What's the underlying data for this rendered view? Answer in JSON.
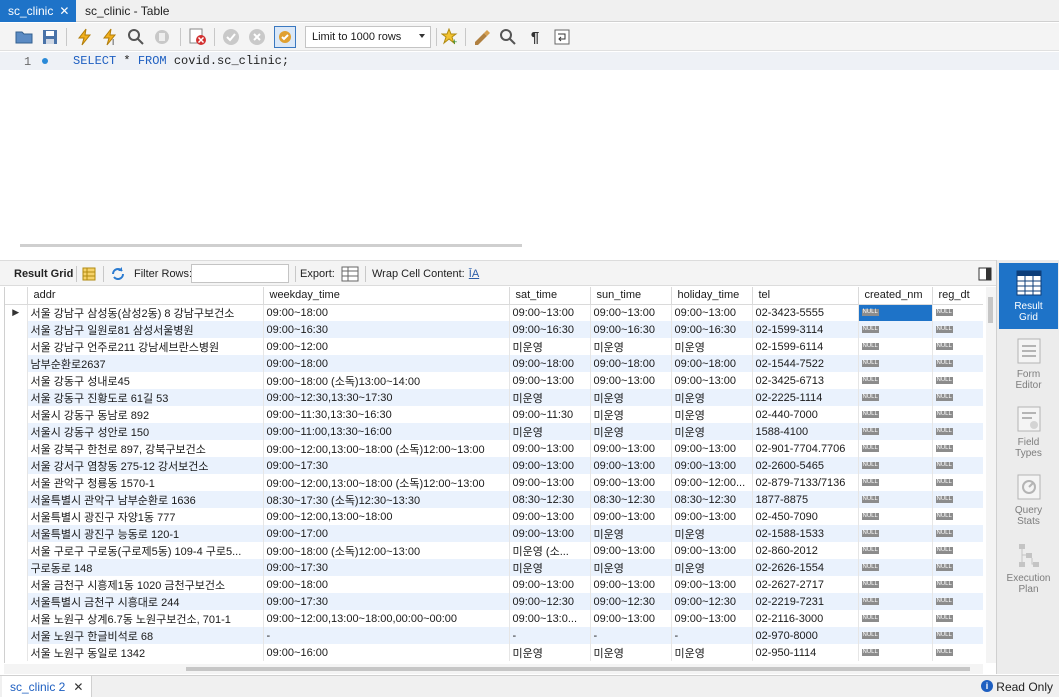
{
  "tabs": [
    {
      "label": "sc_clinic",
      "active": true
    },
    {
      "label": "sc_clinic - Table",
      "active": false
    }
  ],
  "toolbar": {
    "limit_select": "Limit to 1000 rows",
    "icons": [
      "open-folder-icon",
      "save-icon",
      "execute-icon",
      "execute-current-icon",
      "explain-icon",
      "stop-icon",
      "toggle-error-icon",
      "commit-icon",
      "rollback-icon",
      "autocommit-icon",
      "bookmark-icon",
      "beautify-icon",
      "find-icon",
      "invisible-chars-icon",
      "wrap-icon"
    ]
  },
  "editor": {
    "line_number": "1",
    "kw1": "SELECT",
    "mid": " * ",
    "kw2": "FROM",
    "rest": " covid.sc_clinic;"
  },
  "result_toolbar": {
    "result_grid": "Result Grid",
    "filter_rows": "Filter Rows:",
    "export": "Export:",
    "wrap_cell": "Wrap Cell Content:"
  },
  "grid": {
    "columns": [
      "addr",
      "weekday_time",
      "sat_time",
      "sun_time",
      "holiday_time",
      "tel",
      "created_nm",
      "reg_dt"
    ],
    "null_label": "NULL",
    "rows": [
      [
        "서울 강남구 삼성동(삼성2동) 8 강남구보건소",
        "09:00~18:00",
        "09:00~13:00",
        "09:00~13:00",
        "09:00~13:00",
        "02-3423-5555"
      ],
      [
        "서울 강남구 일원로81 삼성서울병원",
        "09:00~16:30",
        "09:00~16:30",
        "09:00~16:30",
        "09:00~16:30",
        "02-1599-3114"
      ],
      [
        "서울 강남구 언주로211 강남세브란스병원",
        "09:00~12:00",
        "미운영",
        "미운영",
        "미운영",
        "02-1599-6114"
      ],
      [
        "남부순환로2637",
        "09:00~18:00",
        "09:00~18:00",
        "09:00~18:00",
        "09:00~18:00",
        "02-1544-7522"
      ],
      [
        "서울 강동구 성내로45",
        "09:00~18:00 (소독)13:00~14:00",
        "09:00~13:00",
        "09:00~13:00",
        "09:00~13:00",
        "02-3425-6713"
      ],
      [
        "서울 강동구 진황도로 61길 53",
        "09:00~12:30,13:30~17:30",
        "미운영",
        "미운영",
        "미운영",
        "02-2225-1114"
      ],
      [
        "서울시 강동구 동남로 892",
        "09:00~11:30,13:30~16:30",
        "09:00~11:30",
        "미운영",
        "미운영",
        "02-440-7000"
      ],
      [
        "서울시 강동구 성안로 150",
        "09:00~11:00,13:30~16:00",
        "미운영",
        "미운영",
        "미운영",
        "1588-4100"
      ],
      [
        "서울 강북구 한천로 897, 강북구보건소",
        "09:00~12:00,13:00~18:00 (소독)12:00~13:00",
        "09:00~13:00",
        "09:00~13:00",
        "09:00~13:00",
        "02-901-7704.7706"
      ],
      [
        "서울 강서구 염창동 275-12 강서보건소",
        "09:00~17:30",
        "09:00~13:00",
        "09:00~13:00",
        "09:00~13:00",
        "02-2600-5465"
      ],
      [
        "서울 관악구 청룡동 1570-1",
        "09:00~12:00,13:00~18:00 (소독)12:00~13:00",
        "09:00~13:00",
        "09:00~13:00",
        "09:00~12:00...",
        "02-879-7133/7136"
      ],
      [
        "서울특별시 관악구 남부순환로 1636",
        "08:30~17:30 (소독)12:30~13:30",
        "08:30~12:30",
        "08:30~12:30",
        "08:30~12:30",
        "1877-8875"
      ],
      [
        "서울특별시 광진구 자양1동 777",
        "09:00~12:00,13:00~18:00",
        "09:00~13:00",
        "09:00~13:00",
        "09:00~13:00",
        "02-450-7090"
      ],
      [
        "서울특별시 광진구 능동로 120-1",
        "09:00~17:00",
        "09:00~13:00",
        "미운영",
        "미운영",
        "02-1588-1533"
      ],
      [
        "서울 구로구 구로동(구로제5동) 109-4 구로5...",
        "09:00~18:00 (소독)12:00~13:00",
        "미운영 (소...",
        "09:00~13:00",
        "09:00~13:00",
        "02-860-2012"
      ],
      [
        "구로동로 148",
        "09:00~17:30",
        "미운영",
        "미운영",
        "미운영",
        "02-2626-1554"
      ],
      [
        "서울 금천구 시흥제1동 1020 금천구보건소",
        "09:00~18:00",
        "09:00~13:00",
        "09:00~13:00",
        "09:00~13:00",
        "02-2627-2717"
      ],
      [
        "서울특별시 금천구 시흥대로 244",
        "09:00~17:30",
        "09:00~12:30",
        "09:00~12:30",
        "09:00~12:30",
        "02-2219-7231"
      ],
      [
        "서울 노원구 상계6.7동 노원구보건소, 701-1",
        "09:00~12:00,13:00~18:00,00:00~00:00",
        "09:00~13:0...",
        "09:00~13:00",
        "09:00~13:00",
        "02-2116-3000"
      ],
      [
        "서울 노원구 한글비석로 68",
        "-",
        "-",
        "-",
        "-",
        "02-970-8000"
      ],
      [
        "서울 노원구 동일로 1342",
        "09:00~16:00",
        "미운영",
        "미운영",
        "미운영",
        "02-950-1114"
      ]
    ]
  },
  "side_panel": [
    {
      "line1": "Result",
      "line2": "Grid",
      "active": true
    },
    {
      "line1": "Form",
      "line2": "Editor",
      "active": false
    },
    {
      "line1": "Field",
      "line2": "Types",
      "active": false
    },
    {
      "line1": "Query",
      "line2": "Stats",
      "active": false
    },
    {
      "line1": "Execution",
      "line2": "Plan",
      "active": false
    }
  ],
  "bottom": {
    "tab_label": "sc_clinic 2",
    "status": "Read Only"
  },
  "colors": {
    "accent": "#1e73c8",
    "row_alt": "#eaf2fd",
    "keyword": "#1e5fc1"
  }
}
